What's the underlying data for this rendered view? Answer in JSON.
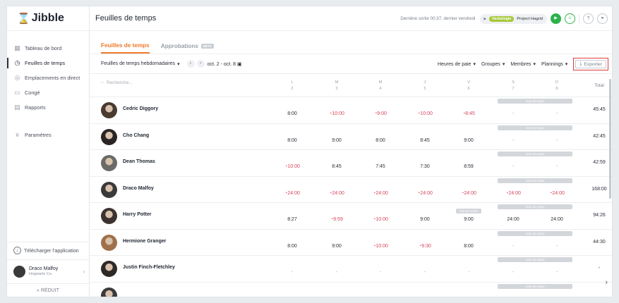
{
  "app": {
    "logo": "Jibble"
  },
  "sidebar": {
    "items": [
      {
        "label": "Tableau de bord",
        "icon": "dashboard-icon",
        "glyph": "▦"
      },
      {
        "label": "Feuilles de temps",
        "icon": "clock-icon",
        "glyph": "◷",
        "active": true
      },
      {
        "label": "Emplacements en direct",
        "icon": "location-icon",
        "glyph": "◎"
      },
      {
        "label": "Congé",
        "icon": "leave-icon",
        "glyph": "▭"
      },
      {
        "label": "Rapports",
        "icon": "reports-icon",
        "glyph": "▤"
      }
    ],
    "settings": {
      "label": "Paramètres",
      "glyph": "∨"
    },
    "download": "Télécharger l'application",
    "user": {
      "name": "Draco Malfoy",
      "org": "Hogwarts Co."
    },
    "collapse": "« RÉDUIT"
  },
  "topbar": {
    "title": "Feuilles de temps",
    "last_out": "Dernière sortie 00:37, dernier vendredi",
    "activity_tag": "Herbologie",
    "project": "Project Hagrid"
  },
  "tabs": [
    {
      "label": "Feuilles de temps",
      "active": true
    },
    {
      "label": "Approbations",
      "badge": "BETA"
    }
  ],
  "toolbar": {
    "view": "Feuilles de temps hebdomadaires",
    "range": "oct. 2 - oct. 8",
    "filters": [
      "Heures de paie",
      "Groupes",
      "Membres",
      "Plannings"
    ],
    "export": "Exporter"
  },
  "table": {
    "search_placeholder": "Recherche...",
    "days": [
      {
        "letter": "L",
        "num": "2"
      },
      {
        "letter": "M",
        "num": "3"
      },
      {
        "letter": "M",
        "num": "4"
      },
      {
        "letter": "J",
        "num": "5"
      },
      {
        "letter": "V",
        "num": "6"
      },
      {
        "letter": "S",
        "num": "7"
      },
      {
        "letter": "D",
        "num": "8"
      }
    ],
    "total_label": "Total",
    "rest_label": "Jour de repos",
    "rows": [
      {
        "name": "Cedric Diggory",
        "cells": [
          "8:00",
          "10:00",
          "9:00",
          "10:00",
          "8:45",
          "-",
          "-"
        ],
        "ot": [
          false,
          true,
          true,
          true,
          true,
          false,
          false
        ],
        "total": "45:45",
        "avatar_color": "#4a3b30"
      },
      {
        "name": "Cho Chang",
        "cells": [
          "8:00",
          "9:00",
          "8:00",
          "8:45",
          "9:00",
          "-",
          "-"
        ],
        "ot": [
          false,
          false,
          false,
          false,
          false,
          false,
          false
        ],
        "total": "42:45",
        "avatar_color": "#2a2524"
      },
      {
        "name": "Dean Thomas",
        "cells": [
          "10:00",
          "8:45",
          "7:45",
          "7:30",
          "8:59",
          "-",
          "-"
        ],
        "ot": [
          true,
          false,
          false,
          false,
          false,
          false,
          false
        ],
        "total": "42:59",
        "avatar_color": "#6a6a68"
      },
      {
        "name": "Draco Malfoy",
        "cells": [
          "24:00",
          "24:00",
          "24:00",
          "24:00",
          "24:00",
          "24:00",
          "24:00"
        ],
        "ot": [
          true,
          true,
          true,
          true,
          true,
          true,
          true
        ],
        "total": "168:00",
        "avatar_color": "#3a3a3a"
      },
      {
        "name": "Harry Potter",
        "cells": [
          "8:27",
          "9:59",
          "10:00",
          "9:00",
          "9:00",
          "24:00",
          "24:00"
        ],
        "ot": [
          false,
          true,
          true,
          false,
          false,
          false,
          false
        ],
        "total": "94:26",
        "avatar_color": "#3c3330",
        "leave_day": 4,
        "leave_label": "Annual Leave"
      },
      {
        "name": "Hermione Granger",
        "cells": [
          "8:00",
          "9:00",
          "10:00",
          "9:30",
          "8:00",
          "-",
          "-"
        ],
        "ot": [
          false,
          false,
          true,
          true,
          false,
          false,
          false
        ],
        "total": "44:30",
        "avatar_color": "#a0704a"
      },
      {
        "name": "Justin Finch-Fletchley",
        "cells": [
          "-",
          "-",
          "-",
          "-",
          "-",
          "-",
          "-"
        ],
        "ot": [
          false,
          false,
          false,
          false,
          false,
          false,
          false
        ],
        "total": "-",
        "avatar_color": "#2e2a28"
      },
      {
        "name": "",
        "cells": [
          "",
          "",
          "",
          "",
          "",
          "",
          ""
        ],
        "ot": [
          false,
          false,
          false,
          false,
          false,
          false,
          false
        ],
        "total": "",
        "avatar_color": "#3a3a3a"
      }
    ]
  },
  "colors": {
    "accent": "#f07a2a",
    "overtime": "#d6455b",
    "play": "#2bb24c",
    "highlight": "#e23b3b"
  }
}
